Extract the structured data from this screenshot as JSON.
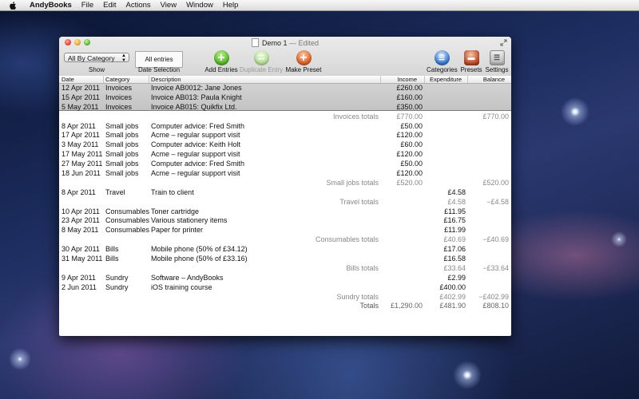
{
  "menubar": {
    "app_name": "AndyBooks",
    "items": [
      "File",
      "Edit",
      "Actions",
      "View",
      "Window",
      "Help"
    ]
  },
  "window": {
    "doc_name": "Demo 1",
    "status": "— Edited"
  },
  "toolbar": {
    "show_value": "All By Category",
    "show_label": "Show",
    "date_value": "All entries",
    "date_label": "Date Selection",
    "add_label": "Add Entries",
    "duplicate_label": "Duplicate Entry",
    "preset_label": "Make Preset",
    "categories_label": "Categories",
    "presets_label": "Presets",
    "settings_label": "Settings"
  },
  "table": {
    "headers": {
      "date": "Date",
      "category": "Category",
      "description": "Description",
      "income": "Income",
      "expenditure": "Expenditure",
      "balance": "Balance"
    },
    "rows": [
      {
        "type": "entry",
        "date": "12 Apr 2011",
        "category": "Invoices",
        "description": "Invoice AB0012: Jane Jones",
        "income": "£260.00",
        "expenditure": "",
        "balance": ""
      },
      {
        "type": "entry",
        "date": "15 Apr 2011",
        "category": "Invoices",
        "description": "Invoice AB013: Paula Knight",
        "income": "£160.00",
        "expenditure": "",
        "balance": ""
      },
      {
        "type": "entry",
        "date": "5 May 2011",
        "category": "Invoices",
        "description": "Invoice AB015: Quikfix Ltd.",
        "income": "£350.00",
        "expenditure": "",
        "balance": ""
      },
      {
        "type": "total",
        "label": "Invoices totals",
        "income": "£770.00",
        "expenditure": "",
        "balance": "£770.00"
      },
      {
        "type": "entry",
        "date": "8 Apr 2011",
        "category": "Small jobs",
        "description": "Computer advice: Fred Smith",
        "income": "£50.00",
        "expenditure": "",
        "balance": ""
      },
      {
        "type": "entry",
        "date": "17 Apr 2011",
        "category": "Small jobs",
        "description": "Acme – regular support visit",
        "income": "£120.00",
        "expenditure": "",
        "balance": ""
      },
      {
        "type": "entry",
        "date": "3 May 2011",
        "category": "Small jobs",
        "description": "Computer advice: Keith Holt",
        "income": "£60.00",
        "expenditure": "",
        "balance": ""
      },
      {
        "type": "entry",
        "date": "17 May 2011",
        "category": "Small jobs",
        "description": "Acme – regular support visit",
        "income": "£120.00",
        "expenditure": "",
        "balance": ""
      },
      {
        "type": "entry",
        "date": "27 May 2011",
        "category": "Small jobs",
        "description": "Computer advice: Fred Smith",
        "income": "£50.00",
        "expenditure": "",
        "balance": ""
      },
      {
        "type": "entry",
        "date": "18 Jun 2011",
        "category": "Small jobs",
        "description": "Acme – regular support visit",
        "income": "£120.00",
        "expenditure": "",
        "balance": ""
      },
      {
        "type": "total",
        "label": "Small jobs totals",
        "income": "£520.00",
        "expenditure": "",
        "balance": "£520.00"
      },
      {
        "type": "entry",
        "date": "8 Apr 2011",
        "category": "Travel",
        "description": "Train to client",
        "income": "",
        "expenditure": "£4.58",
        "balance": ""
      },
      {
        "type": "total",
        "label": "Travel totals",
        "income": "",
        "expenditure": "£4.58",
        "balance": "−£4.58"
      },
      {
        "type": "entry",
        "date": "10 Apr 2011",
        "category": "Consumables",
        "description": "Toner cartridge",
        "income": "",
        "expenditure": "£11.95",
        "balance": ""
      },
      {
        "type": "entry",
        "date": "23 Apr 2011",
        "category": "Consumables",
        "description": "Various stationery items",
        "income": "",
        "expenditure": "£16.75",
        "balance": ""
      },
      {
        "type": "entry",
        "date": "8 May 2011",
        "category": "Consumables",
        "description": "Paper for printer",
        "income": "",
        "expenditure": "£11.99",
        "balance": ""
      },
      {
        "type": "total",
        "label": "Consumables totals",
        "income": "",
        "expenditure": "£40.69",
        "balance": "−£40.69"
      },
      {
        "type": "entry",
        "date": "30 Apr 2011",
        "category": "Bills",
        "description": "Mobile phone (50% of £34.12)",
        "income": "",
        "expenditure": "£17.06",
        "balance": ""
      },
      {
        "type": "entry",
        "date": "31 May 2011",
        "category": "Bills",
        "description": "Mobile phone (50% of £33.16)",
        "income": "",
        "expenditure": "£16.58",
        "balance": ""
      },
      {
        "type": "total",
        "label": "Bills totals",
        "income": "",
        "expenditure": "£33.64",
        "balance": "−£33.64"
      },
      {
        "type": "entry",
        "date": "9 Apr 2011",
        "category": "Sundry",
        "description": "Software – AndyBooks",
        "income": "",
        "expenditure": "£2.99",
        "balance": ""
      },
      {
        "type": "entry",
        "date": "2 Jun 2011",
        "category": "Sundry",
        "description": "iOS training course",
        "income": "",
        "expenditure": "£400.00",
        "balance": ""
      },
      {
        "type": "total",
        "label": "Sundry totals",
        "income": "",
        "expenditure": "£402.99",
        "balance": "−£402.99"
      },
      {
        "type": "grand",
        "label": "Totals",
        "income": "£1,290.00",
        "expenditure": "£481.90",
        "balance": "£808.10"
      }
    ]
  }
}
